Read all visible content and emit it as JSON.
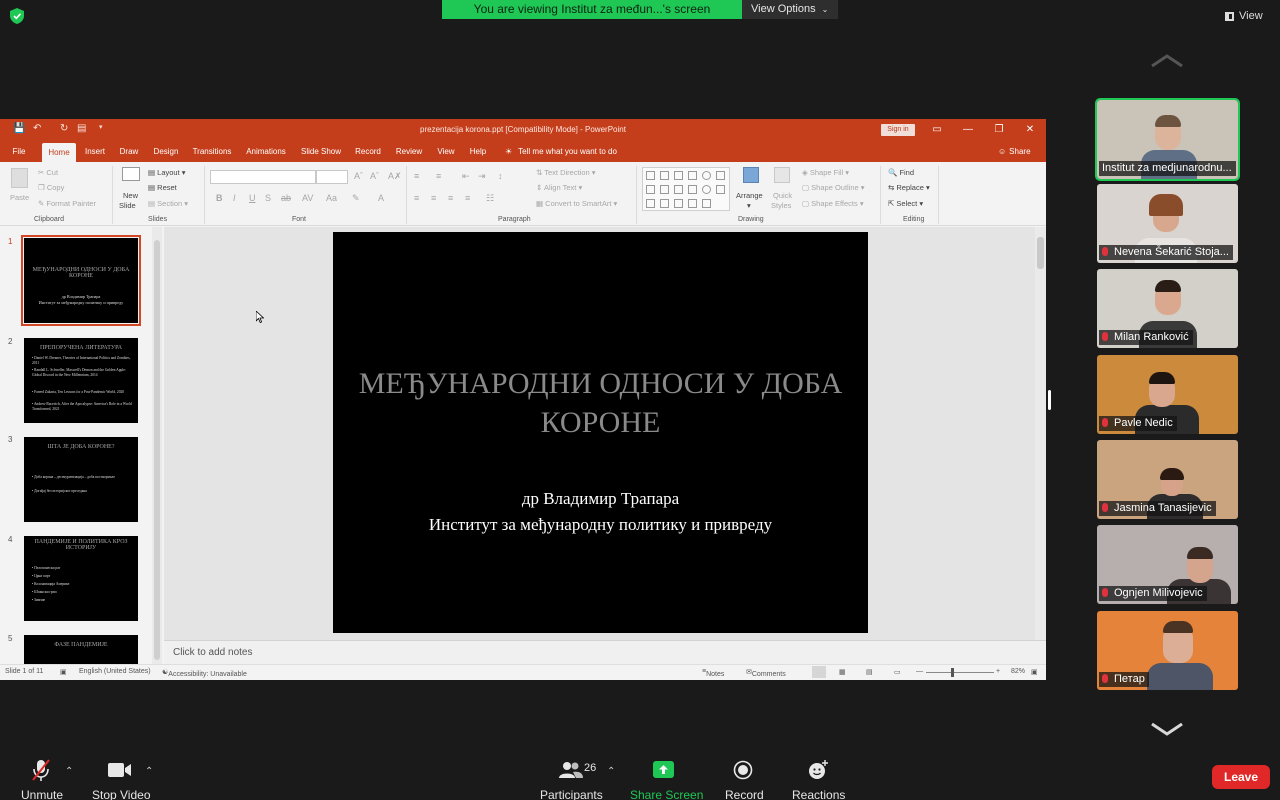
{
  "zoom": {
    "banner": "You are viewing Institut za međun...'s screen",
    "view_options": "View Options",
    "view": "View",
    "toolbar": {
      "unmute": "Unmute",
      "stop_video": "Stop Video",
      "participants": "Participants",
      "participant_count": "26",
      "share_screen": "Share Screen",
      "record": "Record",
      "reactions": "Reactions",
      "leave": "Leave"
    },
    "participants": [
      {
        "name": "Institut za medjunarodnu..."
      },
      {
        "name": "Nevena Šekarić Stoja..."
      },
      {
        "name": "Milan Ranković"
      },
      {
        "name": "Pavle Nedic"
      },
      {
        "name": "Jasmina Tanasijevic"
      },
      {
        "name": "Ognjen Milivojevic"
      },
      {
        "name": "Петар"
      }
    ]
  },
  "ppt": {
    "title": "prezentacija korona.ppt [Compatibility Mode]  -  PowerPoint",
    "sign_in": "Sign in",
    "tabs": [
      "File",
      "Home",
      "Insert",
      "Draw",
      "Design",
      "Transitions",
      "Animations",
      "Slide Show",
      "Record",
      "Review",
      "View",
      "Help"
    ],
    "tell_me": "Tell me what you want to do",
    "share": "Share",
    "ribbon": {
      "paste": "Paste",
      "cut": "Cut",
      "copy": "Copy",
      "format_painter": "Format Painter",
      "clipboard": "Clipboard",
      "new_slide": "New",
      "new_slide2": "Slide",
      "layout": "Layout",
      "reset": "Reset",
      "section": "Section",
      "slides": "Slides",
      "font": "Font",
      "text_direction": "Text Direction",
      "align_text": "Align Text",
      "convert_smartart": "Convert to SmartArt",
      "paragraph": "Paragraph",
      "arrange": "Arrange",
      "quick_styles": "Quick",
      "quick_styles2": "Styles",
      "shape_fill": "Shape Fill",
      "shape_outline": "Shape Outline",
      "shape_effects": "Shape Effects",
      "drawing": "Drawing",
      "find": "Find",
      "replace": "Replace",
      "select": "Select",
      "editing": "Editing"
    },
    "slides": [
      {
        "num": "1",
        "title": "МЕЂУНАРОДНИ ОДНОСИ У ДОБА КОРОНЕ",
        "lines": [
          "др Владимир Трапара",
          "Институт за међународну политику и привреду"
        ]
      },
      {
        "num": "2",
        "title": "ПРЕПОРУЧЕНА ЛИТЕРАТУРА",
        "lines": [
          "• Daniel W. Drezner, Theories of International Politics and Zombies, 2011",
          "• Randall L. Schweller, Maxwell's Demon and the Golden Apple: Global Discord in the New Millennium, 2014",
          "• Fareed Zakaria, Ten Lessons for a Post-Pandemic World, 2020",
          "• Andrew Bacevich, After the Apocalypse: America's Role in a World Transformed, 2021"
        ]
      },
      {
        "num": "3",
        "title": "ШТА ЈЕ ДОБА КОРОНЕ?",
        "lines": [
          "• Доба корона – десекуритизација – доба постнормале",
          "• Догађај без историјског преседана"
        ]
      },
      {
        "num": "4",
        "title": "ПАНДЕМИЈЕ И ПОЛИТИКА КРОЗ ИСТОРИЈУ",
        "lines": [
          "• Пелопонески рат",
          "• Црна смрт",
          "• Колонизација Америке",
          "• Шпански грип",
          "• Зимзие"
        ]
      },
      {
        "num": "5",
        "title": "ФАЗЕ ПАНДЕМИЈЕ",
        "lines": []
      }
    ],
    "current_slide": {
      "title": "МЕЂУНАРОДНИ ОДНОСИ У ДОБА КОРОНЕ",
      "subtitle_1": "др Владимир Трапара",
      "subtitle_2": "Институт за међународну политику и привреду"
    },
    "notes_placeholder": "Click to add notes",
    "status": {
      "slide_of": "Slide 1 of 11",
      "language": "English (United States)",
      "accessibility": "Accessibility: Unavailable",
      "notes": "Notes",
      "comments": "Comments",
      "zoom": "82%"
    }
  },
  "colors": {
    "ppt_accent": "#c43e1c",
    "zoom_green": "#1fc754",
    "leave_red": "#e02828"
  }
}
